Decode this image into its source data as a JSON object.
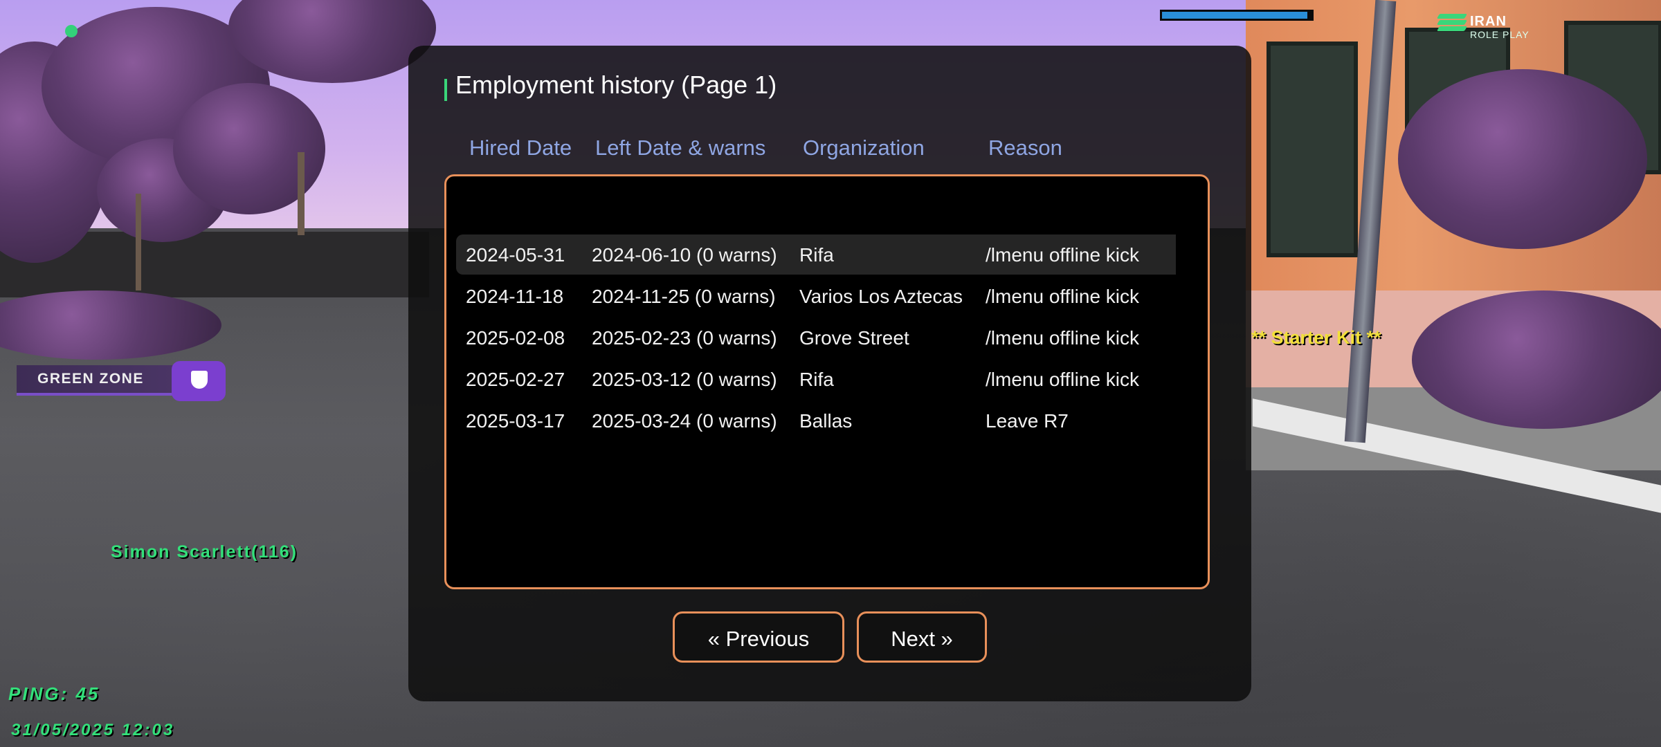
{
  "hud": {
    "health_fraction": 0.97,
    "logo_title": "IRAN",
    "logo_subtitle": "ROLE PLAY",
    "zone_label": "GREEN ZONE",
    "player_tag": "Simon Scarlett(116)",
    "ping_label": "PING: 45",
    "datetime": "31/05/2025 12:03",
    "world_label": "** Starter Kit **"
  },
  "dialog": {
    "title": "Employment history (Page 1)",
    "columns": [
      "Hired Date",
      "Left Date & warns",
      "Organization",
      "Reason"
    ],
    "rows": [
      {
        "hired": "2024-05-31",
        "left": "2024-06-10 (0 warns)",
        "org": "Rifa",
        "reason": "/lmenu offline kick",
        "selected": true
      },
      {
        "hired": "2024-11-18",
        "left": "2024-11-25 (0 warns)",
        "org": "Varios Los Aztecas",
        "reason": "/lmenu offline kick"
      },
      {
        "hired": "2025-02-08",
        "left": "2025-02-23 (0 warns)",
        "org": "Grove Street",
        "reason": "/lmenu offline kick"
      },
      {
        "hired": "2025-02-27",
        "left": "2025-03-12 (0 warns)",
        "org": "Rifa",
        "reason": "/lmenu offline kick"
      },
      {
        "hired": "2025-03-17",
        "left": "2025-03-24 (0 warns)",
        "org": "Ballas",
        "reason": "Leave R7"
      }
    ],
    "prev_label": "« Previous",
    "next_label": "Next »"
  },
  "colors": {
    "accent_border": "#e8905a",
    "header_text": "#8fa6e3",
    "hud_green": "#33e07a",
    "zone_purple": "#7b3fcf"
  },
  "icons": [
    "zone-shield-icon",
    "logo-stripes-icon",
    "status-dot-icon"
  ]
}
